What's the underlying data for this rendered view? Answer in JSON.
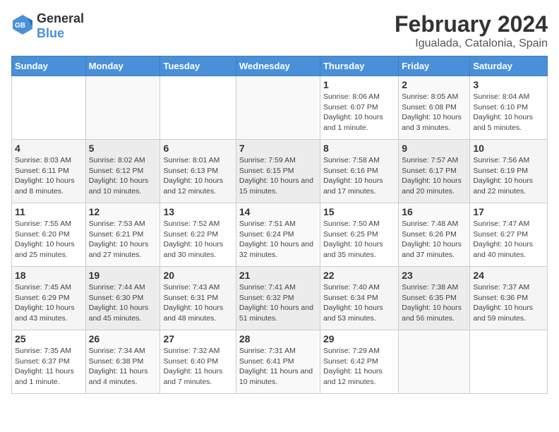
{
  "logo": {
    "general": "General",
    "blue": "Blue"
  },
  "title": "February 2024",
  "subtitle": "Igualada, Catalonia, Spain",
  "days_of_week": [
    "Sunday",
    "Monday",
    "Tuesday",
    "Wednesday",
    "Thursday",
    "Friday",
    "Saturday"
  ],
  "weeks": [
    [
      {
        "day": "",
        "info": ""
      },
      {
        "day": "",
        "info": ""
      },
      {
        "day": "",
        "info": ""
      },
      {
        "day": "",
        "info": ""
      },
      {
        "day": "1",
        "info": "Sunrise: 8:06 AM\nSunset: 6:07 PM\nDaylight: 10 hours and 1 minute."
      },
      {
        "day": "2",
        "info": "Sunrise: 8:05 AM\nSunset: 6:08 PM\nDaylight: 10 hours and 3 minutes."
      },
      {
        "day": "3",
        "info": "Sunrise: 8:04 AM\nSunset: 6:10 PM\nDaylight: 10 hours and 5 minutes."
      }
    ],
    [
      {
        "day": "4",
        "info": "Sunrise: 8:03 AM\nSunset: 6:11 PM\nDaylight: 10 hours and 8 minutes."
      },
      {
        "day": "5",
        "info": "Sunrise: 8:02 AM\nSunset: 6:12 PM\nDaylight: 10 hours and 10 minutes."
      },
      {
        "day": "6",
        "info": "Sunrise: 8:01 AM\nSunset: 6:13 PM\nDaylight: 10 hours and 12 minutes."
      },
      {
        "day": "7",
        "info": "Sunrise: 7:59 AM\nSunset: 6:15 PM\nDaylight: 10 hours and 15 minutes."
      },
      {
        "day": "8",
        "info": "Sunrise: 7:58 AM\nSunset: 6:16 PM\nDaylight: 10 hours and 17 minutes."
      },
      {
        "day": "9",
        "info": "Sunrise: 7:57 AM\nSunset: 6:17 PM\nDaylight: 10 hours and 20 minutes."
      },
      {
        "day": "10",
        "info": "Sunrise: 7:56 AM\nSunset: 6:19 PM\nDaylight: 10 hours and 22 minutes."
      }
    ],
    [
      {
        "day": "11",
        "info": "Sunrise: 7:55 AM\nSunset: 6:20 PM\nDaylight: 10 hours and 25 minutes."
      },
      {
        "day": "12",
        "info": "Sunrise: 7:53 AM\nSunset: 6:21 PM\nDaylight: 10 hours and 27 minutes."
      },
      {
        "day": "13",
        "info": "Sunrise: 7:52 AM\nSunset: 6:22 PM\nDaylight: 10 hours and 30 minutes."
      },
      {
        "day": "14",
        "info": "Sunrise: 7:51 AM\nSunset: 6:24 PM\nDaylight: 10 hours and 32 minutes."
      },
      {
        "day": "15",
        "info": "Sunrise: 7:50 AM\nSunset: 6:25 PM\nDaylight: 10 hours and 35 minutes."
      },
      {
        "day": "16",
        "info": "Sunrise: 7:48 AM\nSunset: 6:26 PM\nDaylight: 10 hours and 37 minutes."
      },
      {
        "day": "17",
        "info": "Sunrise: 7:47 AM\nSunset: 6:27 PM\nDaylight: 10 hours and 40 minutes."
      }
    ],
    [
      {
        "day": "18",
        "info": "Sunrise: 7:45 AM\nSunset: 6:29 PM\nDaylight: 10 hours and 43 minutes."
      },
      {
        "day": "19",
        "info": "Sunrise: 7:44 AM\nSunset: 6:30 PM\nDaylight: 10 hours and 45 minutes."
      },
      {
        "day": "20",
        "info": "Sunrise: 7:43 AM\nSunset: 6:31 PM\nDaylight: 10 hours and 48 minutes."
      },
      {
        "day": "21",
        "info": "Sunrise: 7:41 AM\nSunset: 6:32 PM\nDaylight: 10 hours and 51 minutes."
      },
      {
        "day": "22",
        "info": "Sunrise: 7:40 AM\nSunset: 6:34 PM\nDaylight: 10 hours and 53 minutes."
      },
      {
        "day": "23",
        "info": "Sunrise: 7:38 AM\nSunset: 6:35 PM\nDaylight: 10 hours and 56 minutes."
      },
      {
        "day": "24",
        "info": "Sunrise: 7:37 AM\nSunset: 6:36 PM\nDaylight: 10 hours and 59 minutes."
      }
    ],
    [
      {
        "day": "25",
        "info": "Sunrise: 7:35 AM\nSunset: 6:37 PM\nDaylight: 11 hours and 1 minute."
      },
      {
        "day": "26",
        "info": "Sunrise: 7:34 AM\nSunset: 6:38 PM\nDaylight: 11 hours and 4 minutes."
      },
      {
        "day": "27",
        "info": "Sunrise: 7:32 AM\nSunset: 6:40 PM\nDaylight: 11 hours and 7 minutes."
      },
      {
        "day": "28",
        "info": "Sunrise: 7:31 AM\nSunset: 6:41 PM\nDaylight: 11 hours and 10 minutes."
      },
      {
        "day": "29",
        "info": "Sunrise: 7:29 AM\nSunset: 6:42 PM\nDaylight: 11 hours and 12 minutes."
      },
      {
        "day": "",
        "info": ""
      },
      {
        "day": "",
        "info": ""
      }
    ]
  ]
}
